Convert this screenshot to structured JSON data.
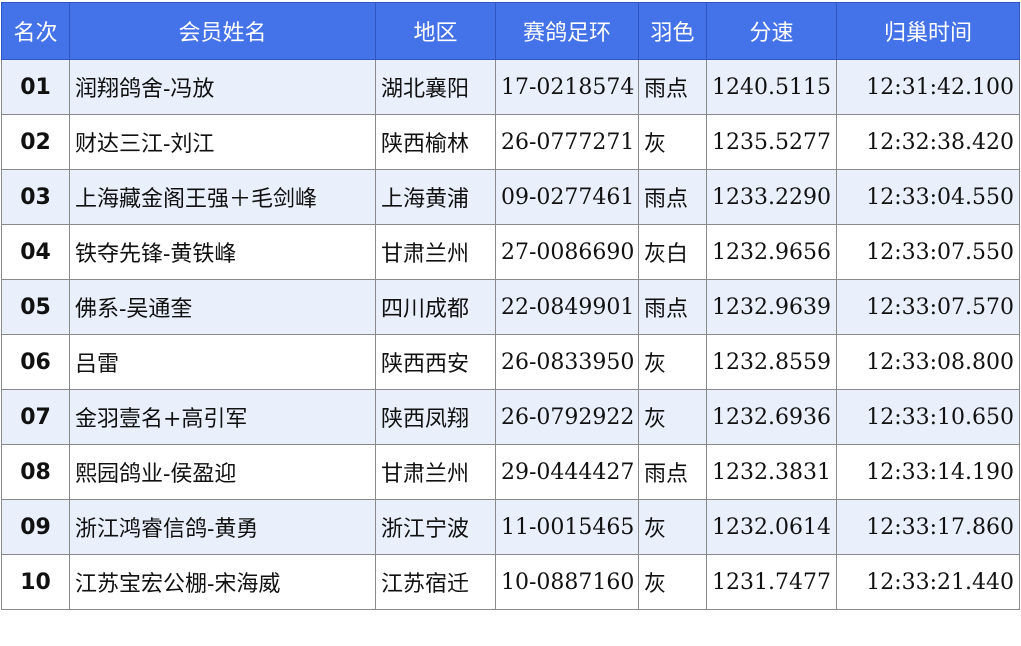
{
  "columns": [
    "名次",
    "会员姓名",
    "地区",
    "赛鸽足环",
    "羽色",
    "分速",
    "归巢时间"
  ],
  "rows": [
    {
      "rank": "01",
      "name": "润翔鸽舍-冯放",
      "region": "湖北襄阳",
      "ring": "17-0218574",
      "color": "雨点",
      "speed": "1240.5115",
      "time": "12:31:42.100"
    },
    {
      "rank": "02",
      "name": "财达三江-刘江",
      "region": "陕西榆林",
      "ring": "26-0777271",
      "color": "灰",
      "speed": "1235.5277",
      "time": "12:32:38.420"
    },
    {
      "rank": "03",
      "name": "上海藏金阁王强＋毛剑峰",
      "region": "上海黄浦",
      "ring": "09-0277461",
      "color": "雨点",
      "speed": "1233.2290",
      "time": "12:33:04.550"
    },
    {
      "rank": "04",
      "name": "铁夺先锋-黄铁峰",
      "region": "甘肃兰州",
      "ring": "27-0086690",
      "color": "灰白",
      "speed": "1232.9656",
      "time": "12:33:07.550"
    },
    {
      "rank": "05",
      "name": "佛系-吴通奎",
      "region": "四川成都",
      "ring": "22-0849901",
      "color": "雨点",
      "speed": "1232.9639",
      "time": "12:33:07.570"
    },
    {
      "rank": "06",
      "name": "吕雷",
      "region": "陕西西安",
      "ring": "26-0833950",
      "color": "灰",
      "speed": "1232.8559",
      "time": "12:33:08.800"
    },
    {
      "rank": "07",
      "name": "金羽壹名+高引军",
      "region": "陕西凤翔",
      "ring": "26-0792922",
      "color": "灰",
      "speed": "1232.6936",
      "time": "12:33:10.650"
    },
    {
      "rank": "08",
      "name": "熙园鸽业-侯盈迎",
      "region": "甘肃兰州",
      "ring": "29-0444427",
      "color": "雨点",
      "speed": "1232.3831",
      "time": "12:33:14.190"
    },
    {
      "rank": "09",
      "name": "浙江鸿睿信鸽-黄勇",
      "region": "浙江宁波",
      "ring": "11-0015465",
      "color": "灰",
      "speed": "1232.0614",
      "time": "12:33:17.860"
    },
    {
      "rank": "10",
      "name": "江苏宝宏公棚-宋海威",
      "region": "江苏宿迁",
      "ring": "10-0887160",
      "color": "灰",
      "speed": "1231.7477",
      "time": "12:33:21.440"
    }
  ],
  "colors": {
    "header_bg": "#4472e8",
    "header_text": "#ffffff",
    "row_alt_bg": "#e9f0fc",
    "name_text": "#1c1c9a"
  }
}
